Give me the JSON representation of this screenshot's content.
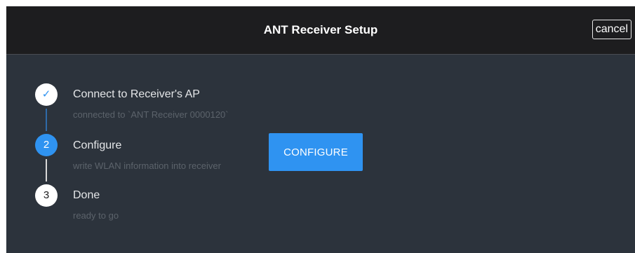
{
  "header": {
    "title": "ANT Receiver Setup",
    "cancel_label": "cancel"
  },
  "steps": [
    {
      "indicator": "✓",
      "title": "Connect to Receiver's AP",
      "subtitle": "connected to `ANT Receiver 0000120`",
      "state": "completed"
    },
    {
      "indicator": "2",
      "title": "Configure",
      "subtitle": "write WLAN information into receiver",
      "state": "active"
    },
    {
      "indicator": "3",
      "title": "Done",
      "subtitle": "ready to go",
      "state": "pending"
    }
  ],
  "actions": {
    "configure_label": "CONFIGURE"
  },
  "colors": {
    "accent": "#2f93f1",
    "header_bg": "#1d1d1f",
    "panel_bg": "#2c333c"
  }
}
